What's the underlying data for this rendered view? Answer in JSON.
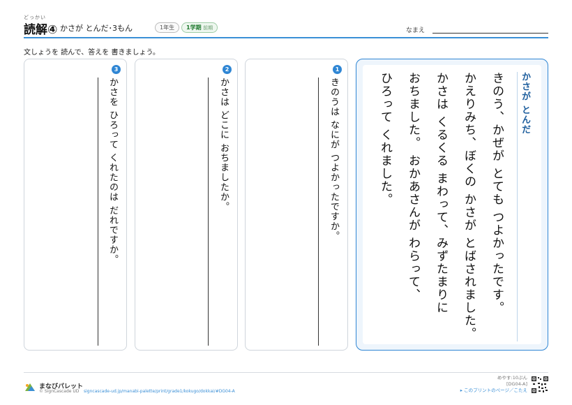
{
  "header": {
    "title_ruby": "どっかい",
    "title": "読解④",
    "subtitle": "かさが とんだ･3もん",
    "grade_badge": "1年生",
    "term_badge_main": "1学期",
    "term_badge_sub": "前期",
    "name_label": "なまえ"
  },
  "instruction": "文しょうを 読んで、答えを 書きましょう。",
  "story": {
    "title": "かさが とんだ",
    "columns": [
      "きのう、かぜが とても つよかったです。",
      "かえりみち、ぼくの かさが とばされました。",
      "かさは くるくる まわって、みずたまりに",
      "おちました。 おかあさんが わらって、",
      "ひろって くれました。"
    ]
  },
  "questions": [
    {
      "number": "1",
      "text": "きのうは なにが つよかったですか。"
    },
    {
      "number": "2",
      "text": "かさは どこに おちましたか。"
    },
    {
      "number": "3",
      "text": "かさを ひろって くれたのは だれですか。"
    }
  ],
  "footer": {
    "brand": "まなびパレット",
    "copyright": "© SignCascade UD",
    "url": "signcascade-ud.jp/manabi-palette/print/grade1/kokugo/dokkai/#DG04-A",
    "time_estimate": "めやす:10ぷん",
    "code": "[DG04-A]",
    "link_text": "▸ このプリントのページ／こたえ"
  },
  "colors": {
    "accent": "#2f86d4",
    "term_green": "#2e8b3e"
  }
}
